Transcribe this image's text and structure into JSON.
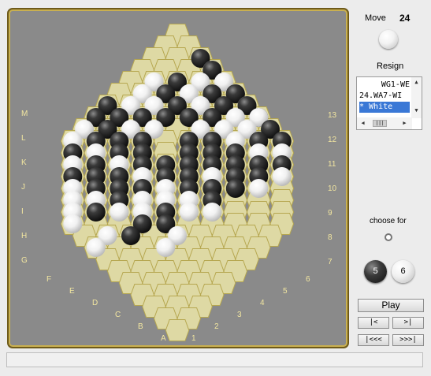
{
  "colors": {
    "cell": "#ded9a4",
    "cell_border": "#b6a750",
    "board_bg": "#8a8a8a",
    "label": "#f2e6a0"
  },
  "sidebar": {
    "move_label": "Move",
    "move_number": "24",
    "resign_label": "Resign",
    "move_list": [
      "WG1-WE",
      "24.WA7-WI",
      "* White"
    ],
    "choose_for_label": "choose for",
    "black_count": "5",
    "white_count": "6",
    "play_label": "Play",
    "nav": {
      "back": "|<",
      "forward": ">|",
      "first": "|<<<",
      "last": ">>>|"
    }
  },
  "board": {
    "left_labels": [
      "M",
      "L",
      "K",
      "J",
      "I",
      "H",
      "G"
    ],
    "bottom_labels_letters": [
      "F",
      "E",
      "D",
      "C",
      "B",
      "A"
    ],
    "right_labels": [
      "13",
      "12",
      "11",
      "10",
      "9",
      "8",
      "7"
    ],
    "bottom_labels_numbers": [
      "6",
      "5",
      "4",
      "3",
      "2",
      "1"
    ],
    "stones": [
      {
        "r": 0,
        "c": 3,
        "color": "black"
      },
      {
        "r": 1,
        "c": 3,
        "color": "white"
      },
      {
        "r": 1,
        "c": 5,
        "color": "black"
      },
      {
        "r": 1,
        "c": 6,
        "color": "white"
      },
      {
        "r": 1,
        "c": 7,
        "color": "black"
      },
      {
        "r": 2,
        "c": 1,
        "color": "white"
      },
      {
        "r": 2,
        "c": 2,
        "color": "black"
      },
      {
        "r": 2,
        "c": 3,
        "color": "white"
      },
      {
        "r": 2,
        "c": 6,
        "color": "white"
      },
      {
        "r": 3,
        "c": 1,
        "color": "white"
      },
      {
        "r": 3,
        "c": 2,
        "color": "black"
      },
      {
        "r": 3,
        "c": 3,
        "color": "white"
      },
      {
        "r": 3,
        "c": 4,
        "color": "black"
      },
      {
        "r": 3,
        "c": 5,
        "color": "white"
      },
      {
        "r": 3,
        "c": 6,
        "color": "black"
      },
      {
        "r": 3,
        "c": 7,
        "color": "black"
      },
      {
        "r": 4,
        "c": 0,
        "color": "black"
      },
      {
        "r": 4,
        "c": 1,
        "color": "white"
      },
      {
        "r": 4,
        "c": 2,
        "color": "white"
      },
      {
        "r": 4,
        "c": 3,
        "color": "black"
      },
      {
        "r": 4,
        "c": 4,
        "color": "white"
      },
      {
        "r": 4,
        "c": 5,
        "color": "black"
      },
      {
        "r": 4,
        "c": 6,
        "color": "white"
      },
      {
        "r": 4,
        "c": 7,
        "color": "black"
      },
      {
        "r": 5,
        "c": 0,
        "color": "black"
      },
      {
        "r": 5,
        "c": 1,
        "color": "black"
      },
      {
        "r": 5,
        "c": 2,
        "color": "black"
      },
      {
        "r": 5,
        "c": 3,
        "color": "black"
      },
      {
        "r": 5,
        "c": 4,
        "color": "black"
      },
      {
        "r": 5,
        "c": 5,
        "color": "black"
      },
      {
        "r": 5,
        "c": 6,
        "color": "white"
      },
      {
        "r": 5,
        "c": 7,
        "color": "black"
      },
      {
        "r": 5,
        "c": 8,
        "color": "white"
      },
      {
        "r": 6,
        "c": 0,
        "color": "white"
      },
      {
        "r": 6,
        "c": 1,
        "color": "black"
      },
      {
        "r": 6,
        "c": 2,
        "color": "white"
      },
      {
        "r": 6,
        "c": 3,
        "color": "white"
      },
      {
        "r": 6,
        "c": 5,
        "color": "white"
      },
      {
        "r": 6,
        "c": 6,
        "color": "white"
      },
      {
        "r": 6,
        "c": 7,
        "color": "white"
      },
      {
        "r": 6,
        "c": 8,
        "color": "black"
      },
      {
        "r": 7,
        "c": 0,
        "color": "white"
      },
      {
        "r": 7,
        "c": 1,
        "color": "black"
      },
      {
        "r": 7,
        "c": 2,
        "color": "black"
      },
      {
        "r": 7,
        "c": 3,
        "color": "black"
      },
      {
        "r": 7,
        "c": 5,
        "color": "black"
      },
      {
        "r": 7,
        "c": 6,
        "color": "black"
      },
      {
        "r": 7,
        "c": 7,
        "color": "white"
      },
      {
        "r": 7,
        "c": 8,
        "color": "black"
      },
      {
        "r": 7,
        "c": 9,
        "color": "black"
      },
      {
        "r": 8,
        "c": 0,
        "color": "black"
      },
      {
        "r": 8,
        "c": 1,
        "color": "white"
      },
      {
        "r": 8,
        "c": 2,
        "color": "black"
      },
      {
        "r": 8,
        "c": 3,
        "color": "black"
      },
      {
        "r": 8,
        "c": 5,
        "color": "black"
      },
      {
        "r": 8,
        "c": 6,
        "color": "black"
      },
      {
        "r": 8,
        "c": 7,
        "color": "black"
      },
      {
        "r": 8,
        "c": 8,
        "color": "white"
      },
      {
        "r": 8,
        "c": 9,
        "color": "white"
      },
      {
        "r": 9,
        "c": 0,
        "color": "white"
      },
      {
        "r": 9,
        "c": 1,
        "color": "black"
      },
      {
        "r": 9,
        "c": 2,
        "color": "white"
      },
      {
        "r": 9,
        "c": 3,
        "color": "black"
      },
      {
        "r": 9,
        "c": 4,
        "color": "black"
      },
      {
        "r": 9,
        "c": 5,
        "color": "black"
      },
      {
        "r": 9,
        "c": 6,
        "color": "black"
      },
      {
        "r": 9,
        "c": 7,
        "color": "black"
      },
      {
        "r": 9,
        "c": 8,
        "color": "black"
      },
      {
        "r": 9,
        "c": 9,
        "color": "black"
      },
      {
        "r": 10,
        "c": 0,
        "color": "black"
      },
      {
        "r": 10,
        "c": 1,
        "color": "black"
      },
      {
        "r": 10,
        "c": 2,
        "color": "black"
      },
      {
        "r": 10,
        "c": 3,
        "color": "white"
      },
      {
        "r": 10,
        "c": 4,
        "color": "black"
      },
      {
        "r": 10,
        "c": 5,
        "color": "black"
      },
      {
        "r": 10,
        "c": 6,
        "color": "white"
      },
      {
        "r": 10,
        "c": 7,
        "color": "black"
      },
      {
        "r": 10,
        "c": 8,
        "color": "black"
      },
      {
        "r": 10,
        "c": 9,
        "color": "white"
      },
      {
        "r": 11,
        "c": 0,
        "color": "white"
      },
      {
        "r": 11,
        "c": 1,
        "color": "black"
      },
      {
        "r": 11,
        "c": 2,
        "color": "black"
      },
      {
        "r": 11,
        "c": 3,
        "color": "black"
      },
      {
        "r": 11,
        "c": 4,
        "color": "white"
      },
      {
        "r": 11,
        "c": 5,
        "color": "black"
      },
      {
        "r": 11,
        "c": 6,
        "color": "black"
      },
      {
        "r": 11,
        "c": 7,
        "color": "black"
      },
      {
        "r": 11,
        "c": 8,
        "color": "white"
      },
      {
        "r": 12,
        "c": 0,
        "color": "white"
      },
      {
        "r": 12,
        "c": 1,
        "color": "white"
      },
      {
        "r": 12,
        "c": 2,
        "color": "black"
      },
      {
        "r": 12,
        "c": 3,
        "color": "white"
      },
      {
        "r": 12,
        "c": 4,
        "color": "white"
      },
      {
        "r": 12,
        "c": 5,
        "color": "white"
      },
      {
        "r": 12,
        "c": 6,
        "color": "black"
      },
      {
        "r": 13,
        "c": 0,
        "color": "white"
      },
      {
        "r": 13,
        "c": 1,
        "color": "black"
      },
      {
        "r": 13,
        "c": 2,
        "color": "white"
      },
      {
        "r": 13,
        "c": 3,
        "color": "white"
      },
      {
        "r": 13,
        "c": 4,
        "color": "black"
      },
      {
        "r": 13,
        "c": 5,
        "color": "white"
      },
      {
        "r": 13,
        "c": 6,
        "color": "white"
      },
      {
        "r": 14,
        "c": 0,
        "color": "white"
      },
      {
        "r": 14,
        "c": 3,
        "color": "black"
      },
      {
        "r": 14,
        "c": 4,
        "color": "black"
      },
      {
        "r": 15,
        "c": 1,
        "color": "white"
      },
      {
        "r": 15,
        "c": 2,
        "color": "black"
      },
      {
        "r": 15,
        "c": 4,
        "color": "white"
      },
      {
        "r": 16,
        "c": 0,
        "color": "white"
      },
      {
        "r": 16,
        "c": 3,
        "color": "white"
      }
    ]
  }
}
